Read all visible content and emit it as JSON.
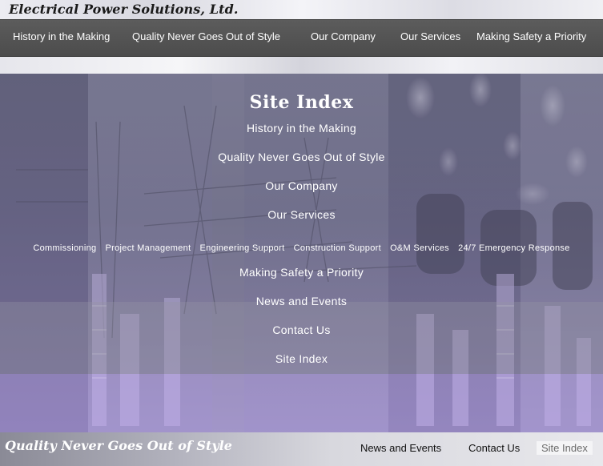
{
  "brand": {
    "name": "Electrical Power Solutions, Ltd."
  },
  "nav": {
    "items": [
      {
        "label": "History in the Making"
      },
      {
        "label": "Quality Never Goes Out of Style"
      },
      {
        "label": "Our Company"
      },
      {
        "label": "Our Services"
      },
      {
        "label": "Making Safety a Priority"
      }
    ]
  },
  "site_index": {
    "title": "Site Index",
    "links": [
      {
        "label": "History in the Making"
      },
      {
        "label": "Quality Never Goes Out of Style"
      },
      {
        "label": "Our Company"
      },
      {
        "label": "Our Services"
      }
    ],
    "service_links": [
      {
        "label": "Commissioning"
      },
      {
        "label": "Project Management"
      },
      {
        "label": "Engineering Support"
      },
      {
        "label": "Construction Support"
      },
      {
        "label": "O&M Services"
      },
      {
        "label": "24/7 Emergency Response"
      }
    ],
    "more_links": [
      {
        "label": "Making Safety a Priority"
      },
      {
        "label": "News and Events"
      },
      {
        "label": "Contact Us"
      },
      {
        "label": "Site Index"
      }
    ]
  },
  "footer": {
    "tagline": "Quality Never Goes Out of Style",
    "links": [
      {
        "label": "News and Events"
      },
      {
        "label": "Contact Us"
      },
      {
        "label": "Site Index"
      }
    ]
  },
  "colors": {
    "nav_bg": "#555555",
    "panel_overlay": "#7a7a8c",
    "hero_tint": "#6b6a8c",
    "text": "#ffffff"
  }
}
